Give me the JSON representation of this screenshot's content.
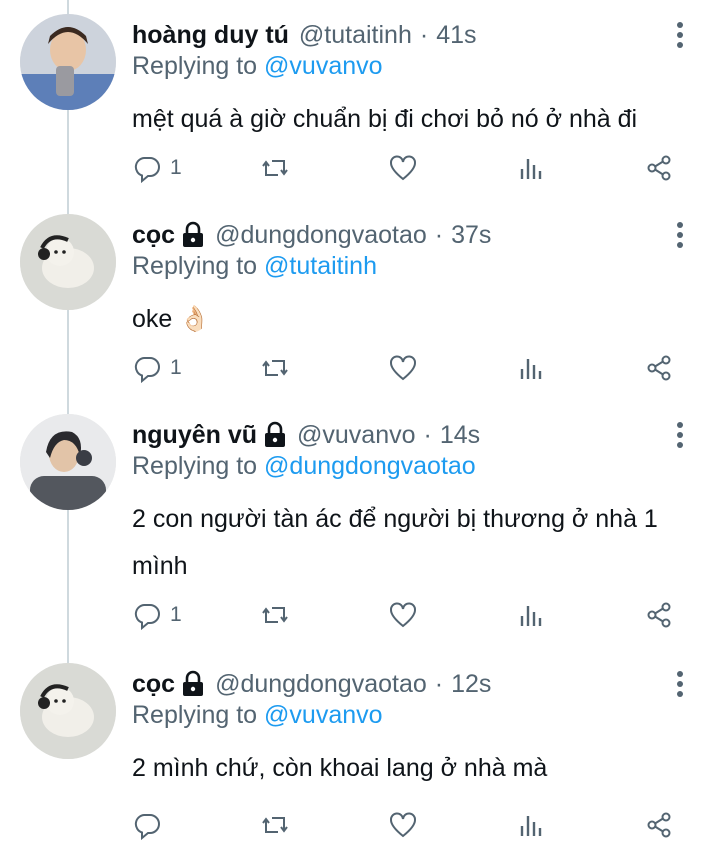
{
  "tweets": [
    {
      "name": "hoàng duy tú",
      "handle": "@tutaitinh",
      "time": "41s",
      "replying_label": "Replying to",
      "replying_to": "@vuvanvo",
      "text": "mệt quá à giờ chuẩn bị đi chơi bỏ nó ở nhà đi",
      "reply_count": "1",
      "protected": false
    },
    {
      "name": "cọc",
      "handle": "@dungdongvaotao",
      "time": "37s",
      "replying_label": "Replying to",
      "replying_to": "@tutaitinh",
      "text": "oke 👌🏻",
      "reply_count": "1",
      "protected": true
    },
    {
      "name": "nguyên vũ",
      "handle": "@vuvanvo",
      "time": "14s",
      "replying_label": "Replying to",
      "replying_to": "@dungdongvaotao",
      "text_line1": "2 con người tàn ác để người bị thương ở nhà 1",
      "text_line2": "mình",
      "reply_count": "1",
      "protected": true
    },
    {
      "name": "cọc",
      "handle": "@dungdongvaotao",
      "time": "12s",
      "replying_label": "Replying to",
      "replying_to": "@vuvanvo",
      "text": "2 mình chứ, còn khoai lang ở nhà mà",
      "reply_count": "",
      "protected": true
    }
  ],
  "separator": "·",
  "icons": [
    "reply-icon",
    "retweet-icon",
    "like-icon",
    "analytics-icon",
    "share-icon",
    "more-icon",
    "lock-icon"
  ],
  "colors": {
    "link": "#1d9bf0",
    "muted": "#536471",
    "text": "#0f1419"
  }
}
